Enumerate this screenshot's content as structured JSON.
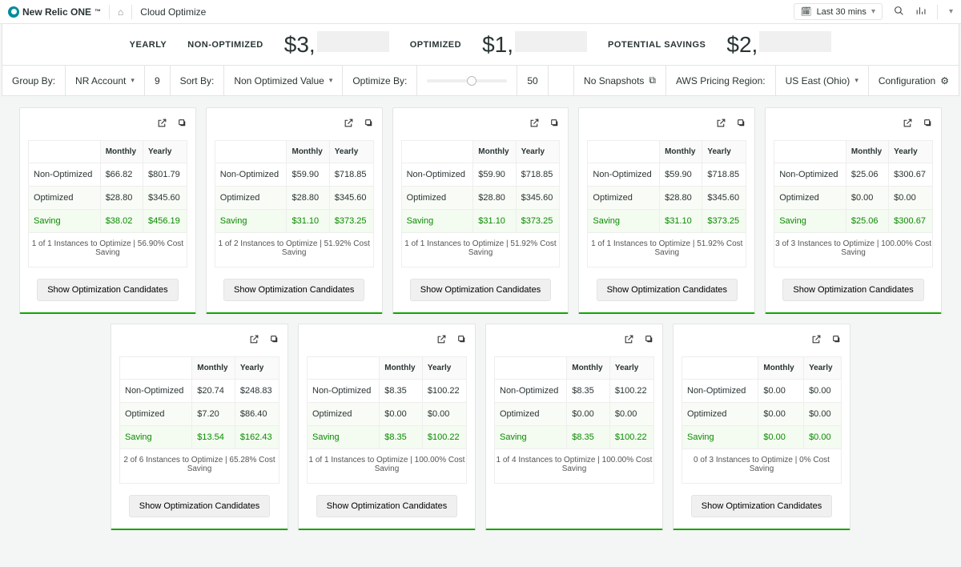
{
  "header": {
    "brand": "New Relic ONE",
    "tm": "™",
    "crumb": "Cloud Optimize",
    "time_range": "Last 30 mins"
  },
  "hero": {
    "yearly_label": "YEARLY",
    "non_opt_label": "NON-OPTIMIZED",
    "non_opt_value": "$3,",
    "opt_label": "OPTIMIZED",
    "opt_value": "$1,",
    "savings_label": "POTENTIAL SAVINGS",
    "savings_value": "$2,"
  },
  "toolbar": {
    "group_by_label": "Group By:",
    "group_by_value": "NR Account",
    "group_count": "9",
    "sort_by_label": "Sort By:",
    "sort_by_value": "Non Optimized Value",
    "optimize_by_label": "Optimize By:",
    "optimize_by_value": "50",
    "no_snapshots": "No Snapshots",
    "pricing_region_label": "AWS Pricing Region:",
    "pricing_region_value": "US East (Ohio)",
    "configuration": "Configuration"
  },
  "table_labels": {
    "monthly": "Monthly",
    "yearly": "Yearly",
    "non_optimized": "Non-Optimized",
    "optimized": "Optimized",
    "saving": "Saving",
    "show_btn": "Show Optimization Candidates"
  },
  "cards": [
    {
      "no_m": "$66.82",
      "no_y": "$801.79",
      "op_m": "$28.80",
      "op_y": "$345.60",
      "sv_m": "$38.02",
      "sv_y": "$456.19",
      "summary": "1 of 1 Instances to Optimize | 56.90% Cost Saving"
    },
    {
      "no_m": "$59.90",
      "no_y": "$718.85",
      "op_m": "$28.80",
      "op_y": "$345.60",
      "sv_m": "$31.10",
      "sv_y": "$373.25",
      "summary": "1 of 2 Instances to Optimize | 51.92% Cost Saving"
    },
    {
      "no_m": "$59.90",
      "no_y": "$718.85",
      "op_m": "$28.80",
      "op_y": "$345.60",
      "sv_m": "$31.10",
      "sv_y": "$373.25",
      "summary": "1 of 1 Instances to Optimize | 51.92% Cost Saving"
    },
    {
      "no_m": "$59.90",
      "no_y": "$718.85",
      "op_m": "$28.80",
      "op_y": "$345.60",
      "sv_m": "$31.10",
      "sv_y": "$373.25",
      "summary": "1 of 1 Instances to Optimize | 51.92% Cost Saving"
    },
    {
      "no_m": "$25.06",
      "no_y": "$300.67",
      "op_m": "$0.00",
      "op_y": "$0.00",
      "sv_m": "$25.06",
      "sv_y": "$300.67",
      "summary": "3 of 3 Instances to Optimize | 100.00% Cost Saving"
    },
    {
      "no_m": "$20.74",
      "no_y": "$248.83",
      "op_m": "$7.20",
      "op_y": "$86.40",
      "sv_m": "$13.54",
      "sv_y": "$162.43",
      "summary": "2 of 6 Instances to Optimize | 65.28% Cost Saving"
    },
    {
      "no_m": "$8.35",
      "no_y": "$100.22",
      "op_m": "$0.00",
      "op_y": "$0.00",
      "sv_m": "$8.35",
      "sv_y": "$100.22",
      "summary": "1 of 1 Instances to Optimize | 100.00% Cost Saving"
    },
    {
      "no_m": "$8.35",
      "no_y": "$100.22",
      "op_m": "$0.00",
      "op_y": "$0.00",
      "sv_m": "$8.35",
      "sv_y": "$100.22",
      "summary": "1 of 4 Instances to Optimize | 100.00% Cost Saving"
    },
    {
      "no_m": "$0.00",
      "no_y": "$0.00",
      "op_m": "$0.00",
      "op_y": "$0.00",
      "sv_m": "$0.00",
      "sv_y": "$0.00",
      "summary": "0 of 3 Instances to Optimize | 0% Cost Saving"
    }
  ]
}
